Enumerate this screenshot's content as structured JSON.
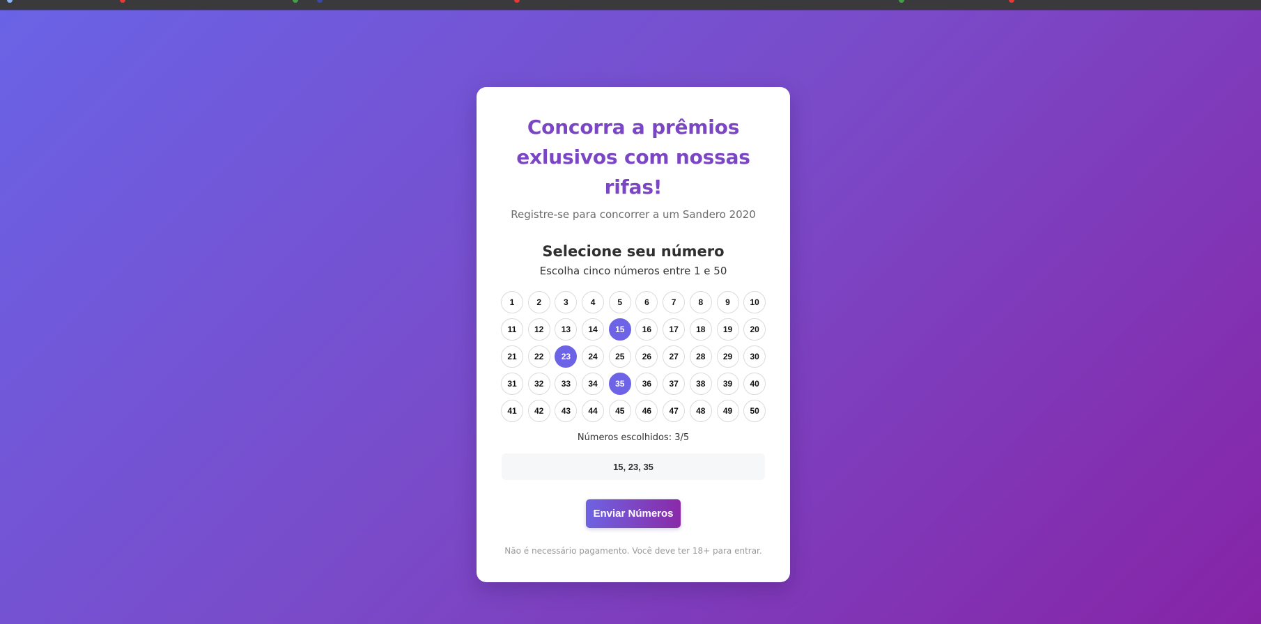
{
  "colors": {
    "accent": "#6c63e6",
    "title": "#7b46c4",
    "background_start": "#6a63e6",
    "background_end": "#8624a6"
  },
  "header": {
    "title": "Concorra a prêmios exlusivos com nossas rifas!",
    "subtitle": "Registre-se para concorrer a um Sandero 2020"
  },
  "picker": {
    "title": "Selecione seu número",
    "instructions": "Escolha cinco números entre 1 e 50",
    "numbers": [
      "1",
      "2",
      "3",
      "4",
      "5",
      "6",
      "7",
      "8",
      "9",
      "10",
      "11",
      "12",
      "13",
      "14",
      "15",
      "16",
      "17",
      "18",
      "19",
      "20",
      "21",
      "22",
      "23",
      "24",
      "25",
      "26",
      "27",
      "28",
      "29",
      "30",
      "31",
      "32",
      "33",
      "34",
      "35",
      "36",
      "37",
      "38",
      "39",
      "40",
      "41",
      "42",
      "43",
      "44",
      "45",
      "46",
      "47",
      "48",
      "49",
      "50"
    ],
    "selected": [
      "15",
      "23",
      "35"
    ],
    "count_label": "Números escolhidos: 3/5",
    "chosen_display": "15, 23, 35"
  },
  "submit_label": "Enviar Números",
  "footer_note": "Não é necessário pagamento. Você deve ter 18+ para entrar."
}
